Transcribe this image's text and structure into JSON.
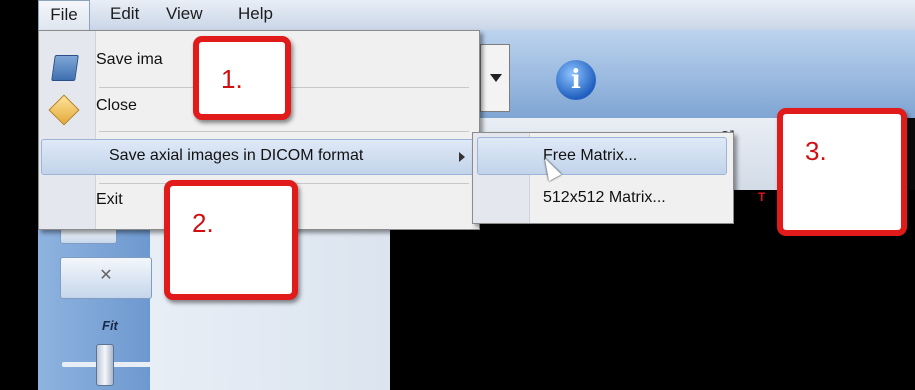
{
  "menu_bar": {
    "items": [
      "File",
      "Edit",
      "View",
      "Help"
    ]
  },
  "file_menu": {
    "save_image": "Save ima",
    "close": "Close",
    "save_axial_dicom": "Save axial images in DICOM format",
    "exit": "Exit"
  },
  "submenu": {
    "free_matrix": "Free Matrix...",
    "matrix_512": "512x512 Matrix..."
  },
  "toolbar": {
    "info_icon": "info-icon",
    "info_glyph": "i",
    "partial_text": "3]",
    "marker": "T"
  },
  "left_panel": {
    "fit_label": "Fit"
  },
  "callouts": [
    {
      "label": "1."
    },
    {
      "label": "2."
    },
    {
      "label": "3."
    }
  ],
  "colors": {
    "callout_border": "#e11a1a",
    "menu_highlight": "#c2d3ea",
    "toolbar_blue": "#7fa5d3"
  }
}
